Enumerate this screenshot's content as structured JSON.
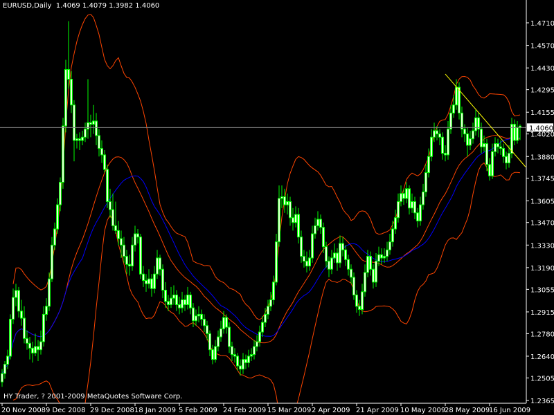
{
  "header": {
    "symbol_timeframe": "EURUSD,Daily",
    "ohlc_text": "1.4069 1.4079 1.3982 1.4060"
  },
  "watermark": "HY Trader, ? 2001-2009 MetaQuotes Software Corp.",
  "colors": {
    "background": "#000000",
    "candle": "#00ff00",
    "candle_body_fill": "#e8ffd8",
    "bands": "#ff4500",
    "moving_average": "#0000ff",
    "trendline": "#ffff00",
    "price_line": "#808080",
    "axis": "#ffffff"
  },
  "chart_data": {
    "type": "candlestick",
    "symbol": "EURUSD",
    "timeframe": "Daily",
    "current_price": "1.4060",
    "ylim": [
      1.2365,
      1.471
    ],
    "y_ticks": [
      "1.4710",
      "1.4570",
      "1.4430",
      "1.4295",
      "1.4155",
      "1.4020",
      "1.3880",
      "1.3745",
      "1.3605",
      "1.3470",
      "1.3330",
      "1.3190",
      "1.3055",
      "1.2915",
      "1.2780",
      "1.2640",
      "1.2505",
      "1.2365"
    ],
    "x_ticks": [
      {
        "bar": 0,
        "label": "20 Nov 2008"
      },
      {
        "bar": 16,
        "label": "9 Dec 2008"
      },
      {
        "bar": 32,
        "label": "29 Dec 2008"
      },
      {
        "bar": 48,
        "label": "18 Jan 2009"
      },
      {
        "bar": 64,
        "label": "5 Feb 2009"
      },
      {
        "bar": 80,
        "label": "24 Feb 2009"
      },
      {
        "bar": 96,
        "label": "15 Mar 2009"
      },
      {
        "bar": 112,
        "label": "2 Apr 2009"
      },
      {
        "bar": 128,
        "label": "21 Apr 2009"
      },
      {
        "bar": 144,
        "label": "10 May 2009"
      },
      {
        "bar": 160,
        "label": "28 May 2009"
      },
      {
        "bar": 176,
        "label": "16 Jun 2009"
      }
    ],
    "trendline": {
      "from": {
        "bar": 160,
        "price": 1.4392
      },
      "to": {
        "bar": 189,
        "price": 1.3815
      }
    },
    "ohlc": [
      [
        1.248,
        1.256,
        1.245,
        1.2532
      ],
      [
        1.2532,
        1.261,
        1.25,
        1.259
      ],
      [
        1.259,
        1.268,
        1.256,
        1.264
      ],
      [
        1.264,
        1.29,
        1.262,
        1.287
      ],
      [
        1.287,
        1.306,
        1.284,
        1.3005
      ],
      [
        1.3005,
        1.309,
        1.295,
        1.3048
      ],
      [
        1.3048,
        1.307,
        1.288,
        1.292
      ],
      [
        1.292,
        1.299,
        1.283,
        1.2876
      ],
      [
        1.2876,
        1.295,
        1.272,
        1.275
      ],
      [
        1.275,
        1.28,
        1.268,
        1.272
      ],
      [
        1.272,
        1.276,
        1.262,
        1.269
      ],
      [
        1.269,
        1.273,
        1.26,
        1.266
      ],
      [
        1.266,
        1.278,
        1.264,
        1.27
      ],
      [
        1.27,
        1.274,
        1.261,
        1.268
      ],
      [
        1.268,
        1.28,
        1.265,
        1.273
      ],
      [
        1.273,
        1.295,
        1.27,
        1.29
      ],
      [
        1.29,
        1.3,
        1.286,
        1.295
      ],
      [
        1.295,
        1.316,
        1.292,
        1.312
      ],
      [
        1.312,
        1.338,
        1.31,
        1.333
      ],
      [
        1.333,
        1.347,
        1.33,
        1.343
      ],
      [
        1.343,
        1.362,
        1.34,
        1.358
      ],
      [
        1.358,
        1.375,
        1.354,
        1.372
      ],
      [
        1.372,
        1.412,
        1.368,
        1.407
      ],
      [
        1.407,
        1.448,
        1.403,
        1.442
      ],
      [
        1.442,
        1.472,
        1.43,
        1.436
      ],
      [
        1.436,
        1.441,
        1.415,
        1.42
      ],
      [
        1.42,
        1.423,
        1.385,
        1.398
      ],
      [
        1.398,
        1.402,
        1.393,
        1.399
      ],
      [
        1.399,
        1.403,
        1.392,
        1.398
      ],
      [
        1.398,
        1.404,
        1.395,
        1.4
      ],
      [
        1.4,
        1.409,
        1.397,
        1.405
      ],
      [
        1.405,
        1.436,
        1.399,
        1.409
      ],
      [
        1.409,
        1.414,
        1.4,
        1.408
      ],
      [
        1.408,
        1.42,
        1.402,
        1.41
      ],
      [
        1.41,
        1.415,
        1.395,
        1.401
      ],
      [
        1.401,
        1.405,
        1.388,
        1.393
      ],
      [
        1.393,
        1.398,
        1.384,
        1.389
      ],
      [
        1.389,
        1.392,
        1.378,
        1.38
      ],
      [
        1.38,
        1.383,
        1.356,
        1.36
      ],
      [
        1.36,
        1.368,
        1.35,
        1.355
      ],
      [
        1.355,
        1.365,
        1.342,
        1.345
      ],
      [
        1.345,
        1.36,
        1.34,
        1.342
      ],
      [
        1.342,
        1.348,
        1.333,
        1.337
      ],
      [
        1.337,
        1.342,
        1.325,
        1.333
      ],
      [
        1.333,
        1.338,
        1.322,
        1.326
      ],
      [
        1.326,
        1.33,
        1.315,
        1.321
      ],
      [
        1.321,
        1.327,
        1.314,
        1.32
      ],
      [
        1.32,
        1.338,
        1.317,
        1.333
      ],
      [
        1.333,
        1.345,
        1.329,
        1.34
      ],
      [
        1.34,
        1.343,
        1.334,
        1.338
      ],
      [
        1.338,
        1.34,
        1.312,
        1.315
      ],
      [
        1.315,
        1.32,
        1.307,
        1.311
      ],
      [
        1.311,
        1.315,
        1.304,
        1.309
      ],
      [
        1.309,
        1.318,
        1.306,
        1.312
      ],
      [
        1.312,
        1.315,
        1.301,
        1.306
      ],
      [
        1.306,
        1.32,
        1.303,
        1.315
      ],
      [
        1.315,
        1.33,
        1.312,
        1.325
      ],
      [
        1.325,
        1.327,
        1.314,
        1.318
      ],
      [
        1.318,
        1.321,
        1.3,
        1.305
      ],
      [
        1.305,
        1.31,
        1.294,
        1.298
      ],
      [
        1.298,
        1.302,
        1.292,
        1.296
      ],
      [
        1.296,
        1.307,
        1.294,
        1.3
      ],
      [
        1.3,
        1.308,
        1.296,
        1.302
      ],
      [
        1.302,
        1.305,
        1.292,
        1.296
      ],
      [
        1.296,
        1.301,
        1.29,
        1.294
      ],
      [
        1.294,
        1.304,
        1.291,
        1.299
      ],
      [
        1.299,
        1.302,
        1.292,
        1.296
      ],
      [
        1.296,
        1.307,
        1.293,
        1.302
      ],
      [
        1.302,
        1.304,
        1.29,
        1.294
      ],
      [
        1.294,
        1.297,
        1.282,
        1.286
      ],
      [
        1.286,
        1.293,
        1.283,
        1.289
      ],
      [
        1.289,
        1.295,
        1.285,
        1.29
      ],
      [
        1.29,
        1.293,
        1.283,
        1.287
      ],
      [
        1.287,
        1.29,
        1.279,
        1.283
      ],
      [
        1.283,
        1.286,
        1.274,
        1.278
      ],
      [
        1.278,
        1.28,
        1.264,
        1.268
      ],
      [
        1.268,
        1.271,
        1.259,
        1.262
      ],
      [
        1.262,
        1.274,
        1.26,
        1.27
      ],
      [
        1.27,
        1.28,
        1.267,
        1.276
      ],
      [
        1.276,
        1.286,
        1.273,
        1.281
      ],
      [
        1.281,
        1.292,
        1.278,
        1.288
      ],
      [
        1.288,
        1.29,
        1.278,
        1.282
      ],
      [
        1.282,
        1.285,
        1.266,
        1.27
      ],
      [
        1.27,
        1.273,
        1.261,
        1.265
      ],
      [
        1.265,
        1.269,
        1.26,
        1.264
      ],
      [
        1.264,
        1.266,
        1.255,
        1.258
      ],
      [
        1.258,
        1.262,
        1.252,
        1.256
      ],
      [
        1.256,
        1.266,
        1.253,
        1.262
      ],
      [
        1.262,
        1.265,
        1.256,
        1.26
      ],
      [
        1.26,
        1.268,
        1.257,
        1.264
      ],
      [
        1.264,
        1.269,
        1.261,
        1.265
      ],
      [
        1.265,
        1.274,
        1.262,
        1.27
      ],
      [
        1.27,
        1.277,
        1.267,
        1.273
      ],
      [
        1.273,
        1.283,
        1.27,
        1.279
      ],
      [
        1.279,
        1.289,
        1.276,
        1.285
      ],
      [
        1.285,
        1.294,
        1.282,
        1.29
      ],
      [
        1.29,
        1.299,
        1.287,
        1.295
      ],
      [
        1.295,
        1.304,
        1.292,
        1.299
      ],
      [
        1.299,
        1.314,
        1.296,
        1.31
      ],
      [
        1.31,
        1.34,
        1.308,
        1.335
      ],
      [
        1.335,
        1.37,
        1.332,
        1.362
      ],
      [
        1.362,
        1.37,
        1.356,
        1.363
      ],
      [
        1.363,
        1.368,
        1.353,
        1.358
      ],
      [
        1.358,
        1.365,
        1.352,
        1.36
      ],
      [
        1.36,
        1.363,
        1.345,
        1.35
      ],
      [
        1.35,
        1.356,
        1.342,
        1.347
      ],
      [
        1.347,
        1.357,
        1.344,
        1.352
      ],
      [
        1.352,
        1.356,
        1.334,
        1.338
      ],
      [
        1.338,
        1.342,
        1.322,
        1.326
      ],
      [
        1.326,
        1.33,
        1.319,
        1.323
      ],
      [
        1.323,
        1.329,
        1.316,
        1.32
      ],
      [
        1.32,
        1.33,
        1.317,
        1.325
      ],
      [
        1.325,
        1.345,
        1.322,
        1.34
      ],
      [
        1.34,
        1.35,
        1.337,
        1.345
      ],
      [
        1.345,
        1.354,
        1.342,
        1.349
      ],
      [
        1.349,
        1.352,
        1.34,
        1.344
      ],
      [
        1.344,
        1.347,
        1.328,
        1.332
      ],
      [
        1.332,
        1.335,
        1.319,
        1.323
      ],
      [
        1.323,
        1.326,
        1.313,
        1.318
      ],
      [
        1.318,
        1.33,
        1.315,
        1.325
      ],
      [
        1.325,
        1.334,
        1.322,
        1.328
      ],
      [
        1.328,
        1.331,
        1.317,
        1.322
      ],
      [
        1.322,
        1.339,
        1.319,
        1.334
      ],
      [
        1.334,
        1.338,
        1.326,
        1.33
      ],
      [
        1.33,
        1.333,
        1.32,
        1.324
      ],
      [
        1.324,
        1.327,
        1.314,
        1.318
      ],
      [
        1.318,
        1.321,
        1.309,
        1.313
      ],
      [
        1.313,
        1.316,
        1.299,
        1.302
      ],
      [
        1.302,
        1.305,
        1.291,
        1.295
      ],
      [
        1.295,
        1.299,
        1.289,
        1.293
      ],
      [
        1.293,
        1.309,
        1.29,
        1.304
      ],
      [
        1.304,
        1.321,
        1.301,
        1.316
      ],
      [
        1.316,
        1.33,
        1.313,
        1.326
      ],
      [
        1.326,
        1.329,
        1.314,
        1.318
      ],
      [
        1.318,
        1.321,
        1.306,
        1.31
      ],
      [
        1.31,
        1.328,
        1.307,
        1.323
      ],
      [
        1.323,
        1.332,
        1.32,
        1.327
      ],
      [
        1.327,
        1.331,
        1.321,
        1.325
      ],
      [
        1.325,
        1.331,
        1.322,
        1.326
      ],
      [
        1.326,
        1.335,
        1.323,
        1.33
      ],
      [
        1.33,
        1.34,
        1.327,
        1.335
      ],
      [
        1.335,
        1.348,
        1.332,
        1.343
      ],
      [
        1.343,
        1.355,
        1.34,
        1.35
      ],
      [
        1.35,
        1.365,
        1.347,
        1.36
      ],
      [
        1.36,
        1.37,
        1.357,
        1.365
      ],
      [
        1.365,
        1.368,
        1.358,
        1.362
      ],
      [
        1.362,
        1.372,
        1.359,
        1.368
      ],
      [
        1.368,
        1.37,
        1.352,
        1.356
      ],
      [
        1.356,
        1.365,
        1.353,
        1.36
      ],
      [
        1.36,
        1.363,
        1.349,
        1.353
      ],
      [
        1.353,
        1.356,
        1.344,
        1.348
      ],
      [
        1.348,
        1.363,
        1.345,
        1.358
      ],
      [
        1.358,
        1.371,
        1.355,
        1.366
      ],
      [
        1.366,
        1.383,
        1.363,
        1.378
      ],
      [
        1.378,
        1.393,
        1.375,
        1.388
      ],
      [
        1.388,
        1.405,
        1.385,
        1.4
      ],
      [
        1.4,
        1.409,
        1.397,
        1.404
      ],
      [
        1.404,
        1.407,
        1.398,
        1.402
      ],
      [
        1.402,
        1.405,
        1.395,
        1.4
      ],
      [
        1.4,
        1.403,
        1.386,
        1.39
      ],
      [
        1.39,
        1.395,
        1.385,
        1.389
      ],
      [
        1.389,
        1.41,
        1.386,
        1.405
      ],
      [
        1.405,
        1.42,
        1.402,
        1.415
      ],
      [
        1.415,
        1.426,
        1.412,
        1.42
      ],
      [
        1.42,
        1.436,
        1.417,
        1.431
      ],
      [
        1.431,
        1.434,
        1.411,
        1.415
      ],
      [
        1.415,
        1.419,
        1.4,
        1.405
      ],
      [
        1.405,
        1.408,
        1.397,
        1.402
      ],
      [
        1.402,
        1.406,
        1.388,
        1.395
      ],
      [
        1.395,
        1.404,
        1.392,
        1.399
      ],
      [
        1.399,
        1.409,
        1.396,
        1.404
      ],
      [
        1.404,
        1.417,
        1.401,
        1.412
      ],
      [
        1.412,
        1.415,
        1.4,
        1.405
      ],
      [
        1.405,
        1.409,
        1.39,
        1.394
      ],
      [
        1.394,
        1.401,
        1.391,
        1.396
      ],
      [
        1.396,
        1.399,
        1.379,
        1.383
      ],
      [
        1.383,
        1.387,
        1.373,
        1.376
      ],
      [
        1.376,
        1.396,
        1.374,
        1.391
      ],
      [
        1.391,
        1.4,
        1.388,
        1.396
      ],
      [
        1.396,
        1.399,
        1.39,
        1.394
      ],
      [
        1.394,
        1.398,
        1.389,
        1.393
      ],
      [
        1.393,
        1.396,
        1.384,
        1.388
      ],
      [
        1.388,
        1.391,
        1.38,
        1.384
      ],
      [
        1.384,
        1.395,
        1.381,
        1.39
      ],
      [
        1.39,
        1.412,
        1.387,
        1.408
      ],
      [
        1.408,
        1.411,
        1.395,
        1.398
      ],
      [
        1.398,
        1.41,
        1.396,
        1.406
      ],
      [
        1.4069,
        1.4079,
        1.3982,
        1.406
      ]
    ]
  }
}
